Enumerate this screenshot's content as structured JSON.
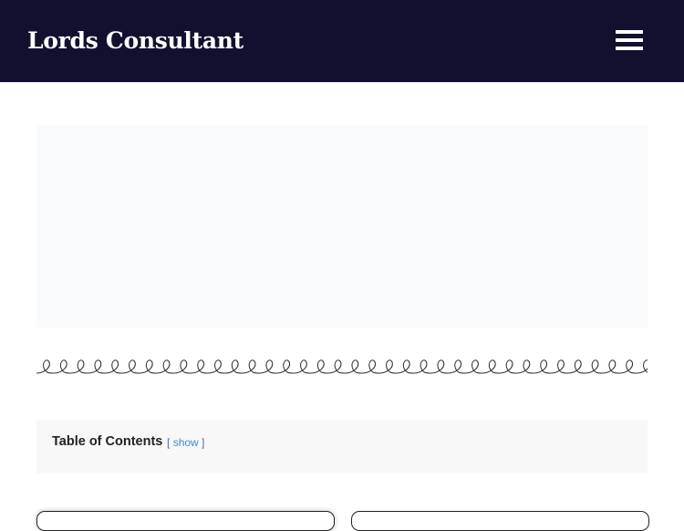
{
  "header": {
    "site_title": "Lords Consultant",
    "menu_icon": "hamburger-menu-icon",
    "background_color": "#11112f"
  },
  "toc": {
    "title": "Table of Contents",
    "open_bracket": "[",
    "toggle_label": "show",
    "close_bracket": "]"
  },
  "colors": {
    "link": "#3c8dd0",
    "placeholder_bg": "#f9fafb",
    "toc_bg": "#f8f8f8"
  }
}
